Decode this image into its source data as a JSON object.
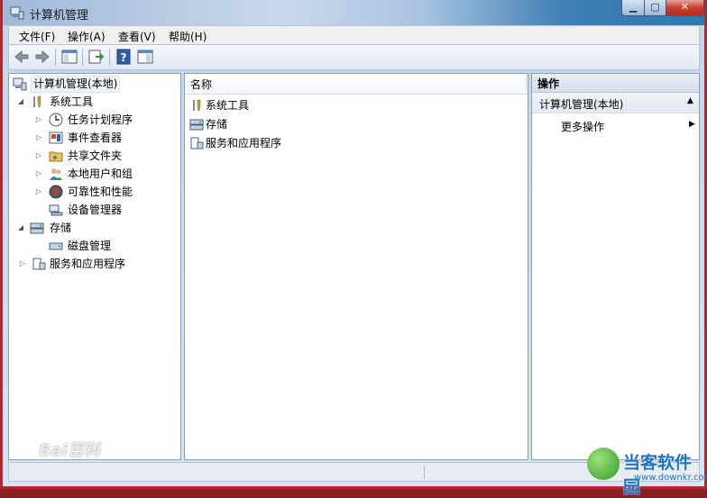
{
  "window": {
    "title": "计算机管理"
  },
  "menubar": {
    "items": [
      "文件(F)",
      "操作(A)",
      "查看(V)",
      "帮助(H)"
    ]
  },
  "tree": {
    "root": "计算机管理(本地)",
    "system_tools": "系统工具",
    "task_scheduler": "任务计划程序",
    "event_viewer": "事件查看器",
    "shared_folders": "共享文件夹",
    "local_users": "本地用户和组",
    "reliability": "可靠性和性能",
    "device_manager": "设备管理器",
    "storage": "存储",
    "disk_management": "磁盘管理",
    "services_apps": "服务和应用程序"
  },
  "list": {
    "header": "名称",
    "items": [
      "系统工具",
      "存储",
      "服务和应用程序"
    ]
  },
  "actions": {
    "header": "操作",
    "section": "计算机管理(本地)",
    "more": "更多操作"
  },
  "watermarks": {
    "baidu": "Bai百科",
    "brand": "当客软件园",
    "url": "www.downkr.com"
  },
  "colors": {
    "accent": "#2c7ab0",
    "frame": "#b3262c"
  }
}
